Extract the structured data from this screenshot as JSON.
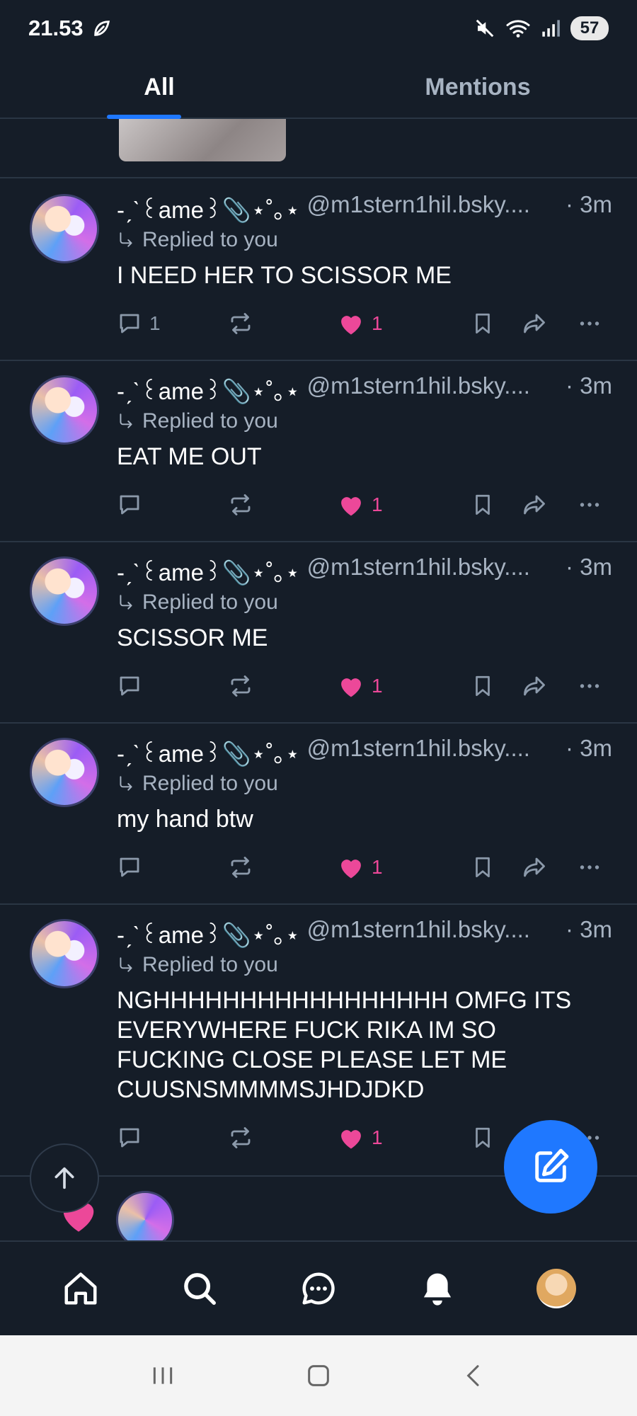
{
  "status_bar": {
    "time": "21.53",
    "battery": "57"
  },
  "tabs": [
    {
      "label": "All",
      "active": true
    },
    {
      "label": "Mentions",
      "active": false
    }
  ],
  "notifications": [
    {
      "display_name": "-ˏˋ꒰ame꒱📎⋆˚｡⋆",
      "handle": "@m1stern1hil.bsky....",
      "time": "· 3m",
      "replied": "Replied to you",
      "text": "I NEED HER TO SCISSOR ME",
      "reply_count": "1",
      "like_count": "1"
    },
    {
      "display_name": "-ˏˋ꒰ame꒱📎⋆˚｡⋆",
      "handle": "@m1stern1hil.bsky....",
      "time": "· 3m",
      "replied": "Replied to you",
      "text": "EAT ME OUT",
      "reply_count": "",
      "like_count": "1"
    },
    {
      "display_name": "-ˏˋ꒰ame꒱📎⋆˚｡⋆",
      "handle": "@m1stern1hil.bsky....",
      "time": "· 3m",
      "replied": "Replied to you",
      "text": "SCISSOR ME",
      "reply_count": "",
      "like_count": "1"
    },
    {
      "display_name": "-ˏˋ꒰ame꒱📎⋆˚｡⋆",
      "handle": "@m1stern1hil.bsky....",
      "time": "· 3m",
      "replied": "Replied to you",
      "text": "my hand btw",
      "reply_count": "",
      "like_count": "1"
    },
    {
      "display_name": "-ˏˋ꒰ame꒱📎⋆˚｡⋆",
      "handle": "@m1stern1hil.bsky....",
      "time": "· 3m",
      "replied": "Replied to you",
      "text": "NGHHHHHHHHHHHHHHHHH OMFG ITS EVERYWHERE FUCK RIKA IM SO FUCKING CLOSE PLEASE LET ME CUUSNSMMMMSJHDJDKD",
      "reply_count": "",
      "like_count": "1"
    }
  ],
  "icons": {
    "reply": "reply-icon",
    "repost": "repost-icon",
    "like": "heart-icon",
    "bookmark": "bookmark-icon",
    "share": "share-icon",
    "more": "more-icon"
  },
  "colors": {
    "background": "#151d28",
    "accent": "#1f78ff",
    "like": "#ec4899",
    "muted_text": "#a7b3c2"
  }
}
